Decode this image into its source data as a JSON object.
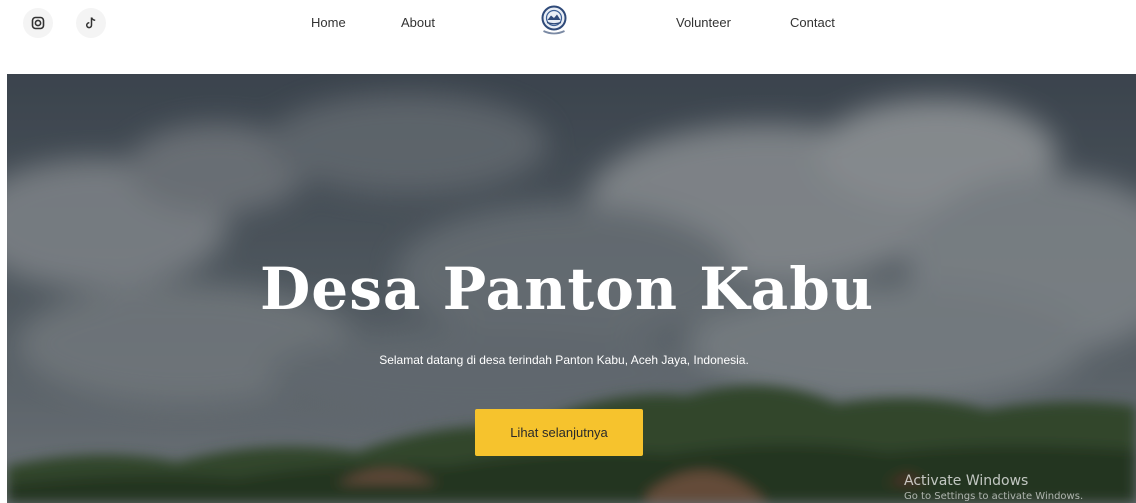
{
  "header": {
    "social": [
      {
        "icon": "instagram-icon"
      },
      {
        "icon": "tiktok-icon"
      }
    ],
    "nav": {
      "home": "Home",
      "about": "About",
      "volunteer": "Volunteer",
      "contact": "Contact"
    },
    "logo": {
      "icon": "village-emblem-icon"
    }
  },
  "hero": {
    "title": "Desa Panton Kabu",
    "subtitle": "Selamat datang di desa terindah Panton Kabu, Aceh Jaya, Indonesia.",
    "cta_label": "Lihat selanjutnya",
    "cta_color": "#f6c32d"
  },
  "watermark": {
    "title": "Activate Windows",
    "subtitle": "Go to Settings to activate Windows."
  }
}
